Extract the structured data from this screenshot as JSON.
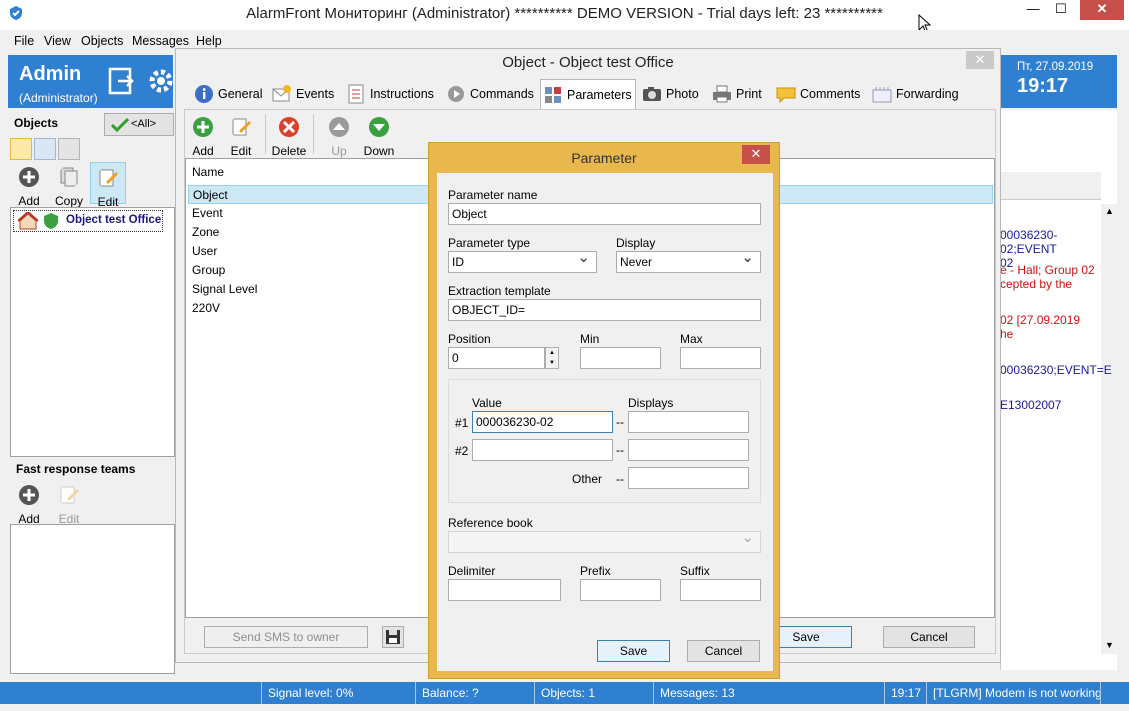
{
  "window": {
    "title": "AlarmFront Мониторинг (Administrator) ********** DEMO VERSION - Trial days left: 23 **********",
    "minimize": "—",
    "maximize": "☐",
    "close": "✕"
  },
  "menu": [
    "File",
    "View",
    "Objects",
    "Messages",
    "Help"
  ],
  "header": {
    "user_name": "Admin",
    "user_role": "(Administrator)",
    "date": "Пт, 27.09.2019",
    "time": "19:17"
  },
  "left_panel": {
    "objects_label": "Objects",
    "filter_label": "<All>",
    "tools": [
      "Add",
      "Copy",
      "Edit"
    ],
    "tree_item": "Object test Office",
    "teams_label": "Fast response teams",
    "team_tools": [
      "Add",
      "Edit"
    ]
  },
  "object_dialog": {
    "title": "Object - Object test Office",
    "close": "✕",
    "tabs": [
      "General",
      "Events",
      "Instructions",
      "Commands",
      "Parameters",
      "Photo",
      "Print",
      "Comments",
      "Forwarding"
    ],
    "toolbar": [
      "Add",
      "Edit",
      "Delete",
      "Up",
      "Down"
    ],
    "list_header": "Name",
    "rows": [
      "Object",
      "Event",
      "Zone",
      "User",
      "Group",
      "Signal Level",
      "220V"
    ],
    "sms_button": "Send SMS to owner",
    "save_button": "Save",
    "cancel_button": "Cancel"
  },
  "param_dialog": {
    "title": "Parameter",
    "close": "✕",
    "name_label": "Parameter name",
    "name_value": "Object",
    "type_label": "Parameter type",
    "type_value": "ID",
    "display_label": "Display",
    "display_value": "Never",
    "template_label": "Extraction template",
    "template_value": "OBJECT_ID=",
    "position_label": "Position",
    "position_value": "0",
    "min_label": "Min",
    "max_label": "Max",
    "value_label": "Value",
    "displays_label": "Displays",
    "row1_label": "#1",
    "row1_value": "000036230-02",
    "row2_label": "#2",
    "other_label": "Other",
    "dash": "--",
    "reference_label": "Reference book",
    "delimiter_label": "Delimiter",
    "prefix_label": "Prefix",
    "suffix_label": "Suffix",
    "save_button": "Save",
    "cancel_button": "Cancel"
  },
  "events_panel": {
    "e1a": "00036230-02;EVENT",
    "e1b": "02",
    "e2a": "e - Hall; Group 02",
    "e2b": "cepted by the",
    "e3a": "02 [27.09.2019",
    "e3b": "he",
    "e4": "00036230;EVENT=E",
    "e5": "E13002007"
  },
  "statusbar": {
    "signal": "Signal level:  0%",
    "balance": "Balance:  ?",
    "objects": "Objects:  1",
    "messages": "Messages:  13",
    "time": "19:17",
    "modem": "[TLGRM] Modem is not working"
  },
  "colors": {
    "accent_blue": "#2f80d0",
    "dialog_orange": "#e8b84f",
    "close_red": "#c7504a",
    "selected_row": "#cce8f4"
  }
}
